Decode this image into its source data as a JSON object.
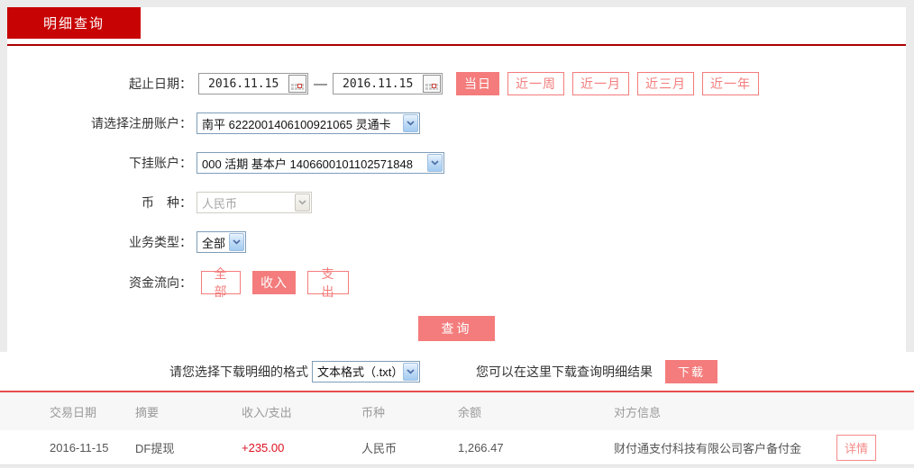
{
  "tab": {
    "label": "明细查询"
  },
  "form": {
    "date_row": {
      "label": "起止日期：",
      "start_date": "2016.11.15",
      "end_date": "2016.11.15",
      "separator": "—",
      "quick_buttons": [
        {
          "label": "当日",
          "active": true
        },
        {
          "label": "近一周",
          "active": false
        },
        {
          "label": "近一月",
          "active": false
        },
        {
          "label": "近三月",
          "active": false
        },
        {
          "label": "近一年",
          "active": false
        }
      ]
    },
    "registered_account": {
      "label": "请选择注册账户：",
      "value": "南平 6222001406100921065 灵通卡"
    },
    "sub_account": {
      "label": "下挂账户：",
      "value": "000 活期 基本户 1406600101102571848"
    },
    "currency": {
      "label": "币　种：",
      "value": "人民币",
      "disabled": true
    },
    "business_type": {
      "label": "业务类型：",
      "value": "全部"
    },
    "fund_direction": {
      "label": "资金流向：",
      "options": [
        {
          "label": "全部",
          "active": false
        },
        {
          "label": "收入",
          "active": true
        },
        {
          "label": "支出",
          "active": false
        }
      ]
    },
    "query_button": "查询"
  },
  "download": {
    "format_label": "请您选择下载明细的格式",
    "format_value": "文本格式（.txt）",
    "hint": "您可以在这里下载查询明细结果",
    "button": "下载"
  },
  "table": {
    "headers": [
      "交易日期",
      "摘要",
      "收入/支出",
      "币种",
      "余额",
      "对方信息"
    ],
    "rows": [
      {
        "date": "2016-11-15",
        "summary": "DF提现",
        "amount": "+235.00",
        "currency": "人民币",
        "balance": "1,266.47",
        "counterparty": "财付通支付科技有限公司客户备付金",
        "detail_button": "详情"
      }
    ]
  },
  "colors": {
    "brand_red": "#c80303",
    "tab_underline_red": "#ab0000",
    "accent_salmon": "#f47c7c",
    "table_rule_red": "#e84c4c",
    "amount_red": "#dd1122",
    "select_border_blue": "#7f9db9",
    "header_text_gray": "#9b9b9b"
  }
}
